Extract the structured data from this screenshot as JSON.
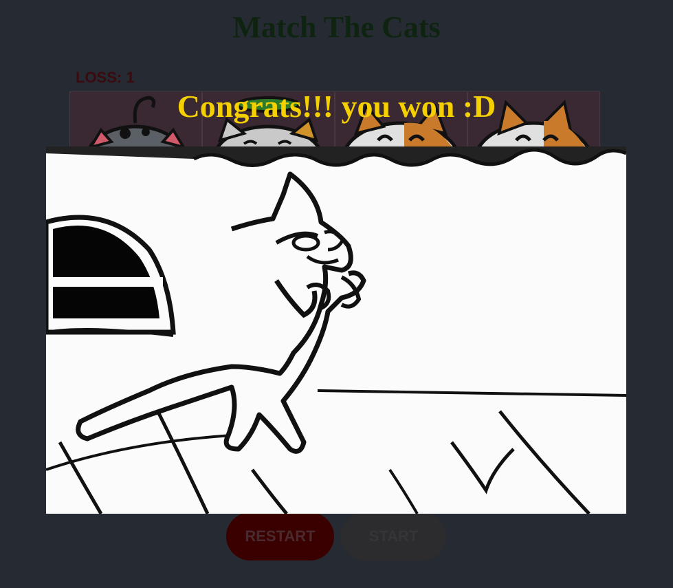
{
  "game": {
    "title": "Match The Cats",
    "loss_label": "LOSS: 1",
    "win_message": "Congrats!!! you won :D"
  },
  "cards": [
    {
      "icon": "spotted-cat-icon"
    },
    {
      "icon": "hat-cat-icon"
    },
    {
      "icon": "orange-cat-icon"
    },
    {
      "icon": "orange-cat-icon"
    }
  ],
  "controls": {
    "restart_label": "RESTART",
    "start_label": "START"
  },
  "colors": {
    "background": "#262b33",
    "title": "#0f2410",
    "win_message": "#f5d000",
    "restart": "#3a0000",
    "start": "#2c2c2e"
  }
}
